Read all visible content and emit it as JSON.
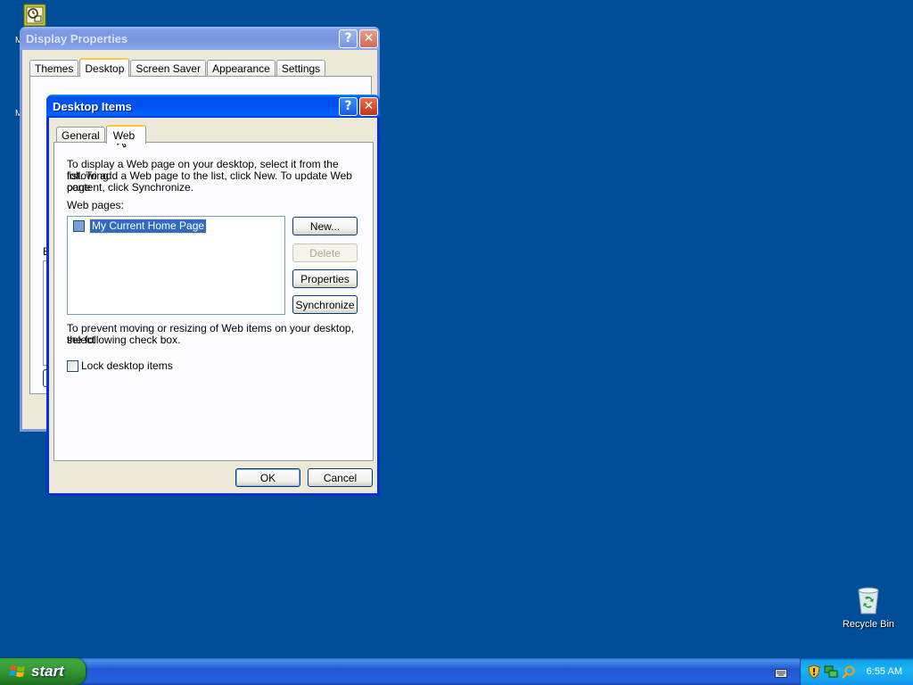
{
  "desktop": {
    "recycle_bin_label": "Recycle Bin",
    "partial_label_1": "M",
    "partial_label_2": "M",
    "partial_label_3": "B"
  },
  "display_properties": {
    "title": "Display Properties",
    "help_glyph": "?",
    "close_glyph": "✕",
    "tabs": [
      "Themes",
      "Desktop",
      "Screen Saver",
      "Appearance",
      "Settings"
    ],
    "active_tab": "Desktop"
  },
  "desktop_items": {
    "title": "Desktop Items",
    "help_glyph": "?",
    "close_glyph": "✕",
    "tabs": [
      "General",
      "Web"
    ],
    "active_tab": "Web",
    "intro_line_1": "To display a Web page on your desktop, select it from the following",
    "intro_line_2": "list. To add a Web page to the list, click New.  To update Web page",
    "intro_line_3": "content, click Synchronize.",
    "web_pages_label": "Web pages:",
    "web_pages": [
      {
        "label": "My Current Home Page",
        "checked": false,
        "selected": true
      }
    ],
    "buttons": {
      "new": "New...",
      "delete": "Delete",
      "properties": "Properties",
      "synchronize": "Synchronize"
    },
    "lock_text_line_1": "To prevent moving or resizing of Web items on your desktop, select",
    "lock_text_line_2": "the following check box.",
    "lock_checkbox_label": "Lock desktop items",
    "lock_checked": false,
    "ok": "OK",
    "cancel": "Cancel"
  },
  "taskbar": {
    "start_label": "start",
    "clock": "6:55 AM"
  },
  "colors": {
    "desktop": "#004e98",
    "selection": "#316ac5",
    "tab_highlight": "#ffc83c"
  }
}
